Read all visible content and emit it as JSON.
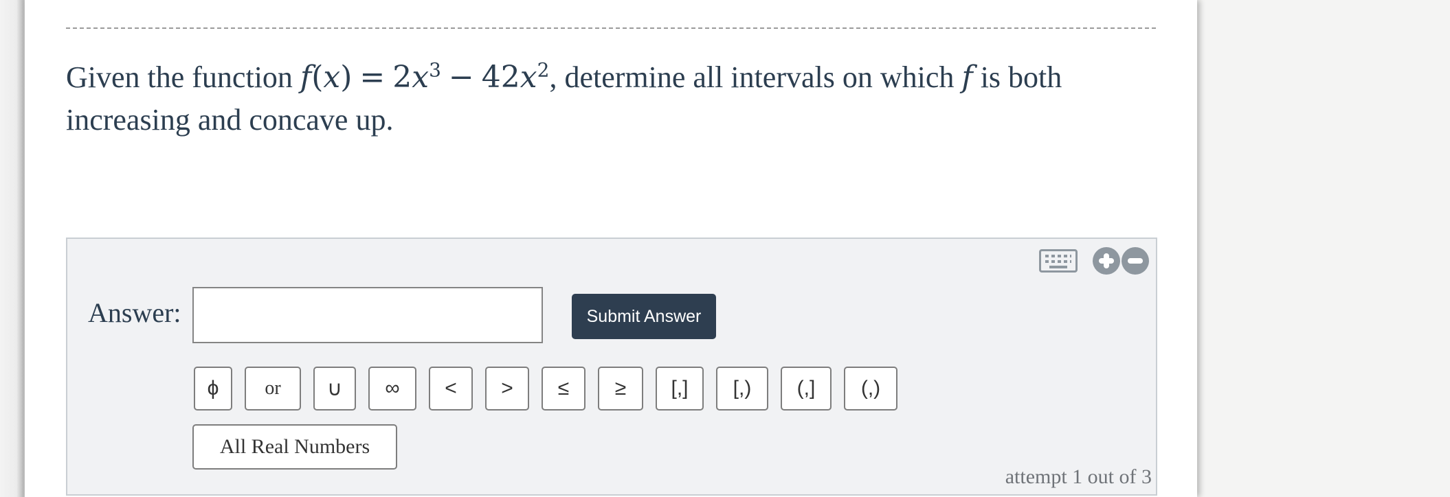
{
  "question": {
    "prefix": "Given the function ",
    "function_name": "f",
    "variable": "x",
    "equals": "=",
    "term1_coef": "2",
    "term1_var": "x",
    "term1_exp": "3",
    "minus": "−",
    "term2_coef": "42",
    "term2_var": "x",
    "term2_exp": "2",
    "middle": ", determine all intervals on which ",
    "f_symbol": "f",
    "suffix": " is both increasing and concave up."
  },
  "answer": {
    "label": "Answer:",
    "input_value": "",
    "submit_label": "Submit Answer"
  },
  "toolbar": {
    "keyboard_icon": "keyboard-icon",
    "zoom_in_icon": "plus-circle-icon",
    "zoom_out_icon": "minus-circle-icon"
  },
  "symbols": [
    {
      "label": "ϕ",
      "name": "empty-set"
    },
    {
      "label": "or",
      "name": "or"
    },
    {
      "label": "∪",
      "name": "union"
    },
    {
      "label": "∞",
      "name": "infinity"
    },
    {
      "label": "<",
      "name": "less-than"
    },
    {
      "label": ">",
      "name": "greater-than"
    },
    {
      "label": "≤",
      "name": "less-equal"
    },
    {
      "label": "≥",
      "name": "greater-equal"
    },
    {
      "label": "[,]",
      "name": "closed-interval"
    },
    {
      "label": "[,)",
      "name": "closed-open-interval"
    },
    {
      "label": "(,]",
      "name": "open-closed-interval"
    },
    {
      "label": "(,)",
      "name": "open-interval"
    }
  ],
  "all_real_label": "All Real Numbers",
  "attempt_text": "attempt 1 out of 3"
}
